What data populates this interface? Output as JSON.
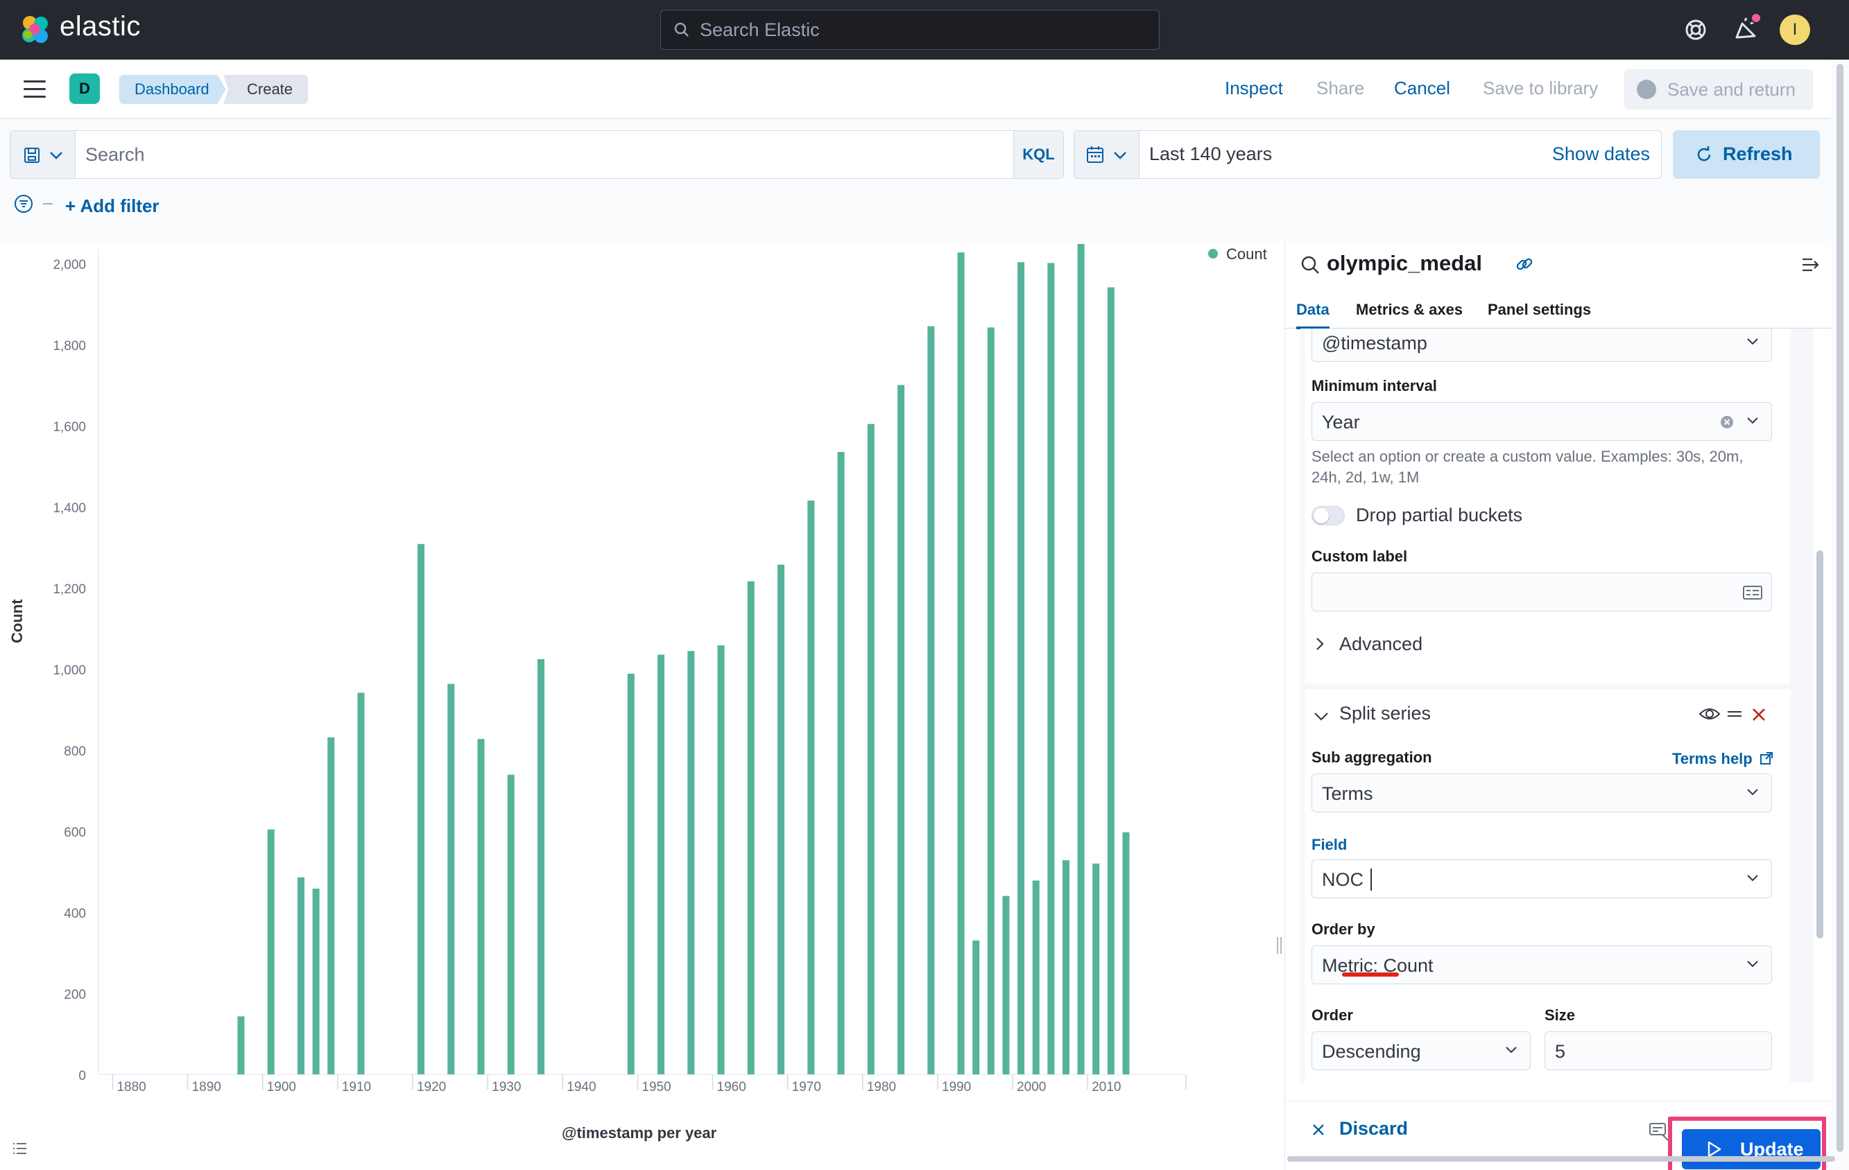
{
  "header": {
    "brand": "elastic",
    "search_placeholder": "Search Elastic",
    "avatar_initial": "I"
  },
  "subbar": {
    "space_initial": "D",
    "breadcrumbs": [
      "Dashboard",
      "Create"
    ],
    "inspect": "Inspect",
    "share": "Share",
    "cancel": "Cancel",
    "save_to_library": "Save to library",
    "save_and_return": "Save and return"
  },
  "query": {
    "search_placeholder": "Search",
    "language": "KQL",
    "time_range": "Last 140 years",
    "show_dates": "Show dates",
    "refresh": "Refresh",
    "add_filter": "+ Add filter"
  },
  "chart_data": {
    "type": "bar",
    "title": "",
    "xlabel": "@timestamp per year",
    "ylabel": "Count",
    "legend": [
      {
        "name": "Count",
        "color": "#54b399"
      }
    ],
    "legend_position": "top-right",
    "xlim": [
      1877,
      2022
    ],
    "ylim": [
      0,
      2000
    ],
    "x_ticks": [
      1880,
      1890,
      1900,
      1910,
      1920,
      1930,
      1940,
      1950,
      1960,
      1970,
      1980,
      1990,
      2000,
      2010
    ],
    "y_ticks": [
      0,
      200,
      400,
      600,
      800,
      1000,
      1200,
      1400,
      1600,
      1800,
      2000
    ],
    "y_tick_labels": [
      "0",
      "200",
      "400",
      "600",
      "800",
      "1,000",
      "1,200",
      "1,400",
      "1,600",
      "1,800",
      "2,000"
    ],
    "series": [
      {
        "name": "Count",
        "color": "#54b399",
        "x": [
          1896,
          1900,
          1904,
          1906,
          1908,
          1912,
          1920,
          1924,
          1928,
          1932,
          1936,
          1948,
          1952,
          1956,
          1960,
          1964,
          1968,
          1972,
          1976,
          1980,
          1984,
          1988,
          1992,
          1994,
          1996,
          1998,
          2000,
          2002,
          2004,
          2006,
          2008,
          2010,
          2012,
          2014
        ],
        "values": [
          143,
          604,
          486,
          458,
          831,
          941,
          1308,
          963,
          827,
          739,
          1024,
          988,
          1035,
          1044,
          1058,
          1216,
          1257,
          1415,
          1535,
          1604,
          1700,
          1845,
          2027,
          330,
          1842,
          440,
          2003,
          478,
          2001,
          528,
          2048,
          520,
          1941,
          597
        ]
      }
    ],
    "grid": false
  },
  "panel": {
    "index_name": "olympic_medal",
    "tabs": [
      "Data",
      "Metrics & axes",
      "Panel settings"
    ],
    "field_value": "@timestamp",
    "min_interval_label": "Minimum interval",
    "min_interval_value": "Year",
    "min_interval_help": "Select an option or create a custom value. Examples: 30s, 20m, 24h, 2d, 1w, 1M",
    "drop_partial": "Drop partial buckets",
    "custom_label": "Custom label",
    "advanced": "Advanced",
    "split_series": "Split series",
    "sub_agg_label": "Sub aggregation",
    "terms_help": "Terms help",
    "sub_agg_value": "Terms",
    "field_label": "Field",
    "field_input": "NOC",
    "order_by_label": "Order by",
    "order_by_value": "Metric: Count",
    "order_label": "Order",
    "order_value": "Descending",
    "size_label": "Size",
    "size_value": "5",
    "discard": "Discard",
    "update": "Update"
  }
}
